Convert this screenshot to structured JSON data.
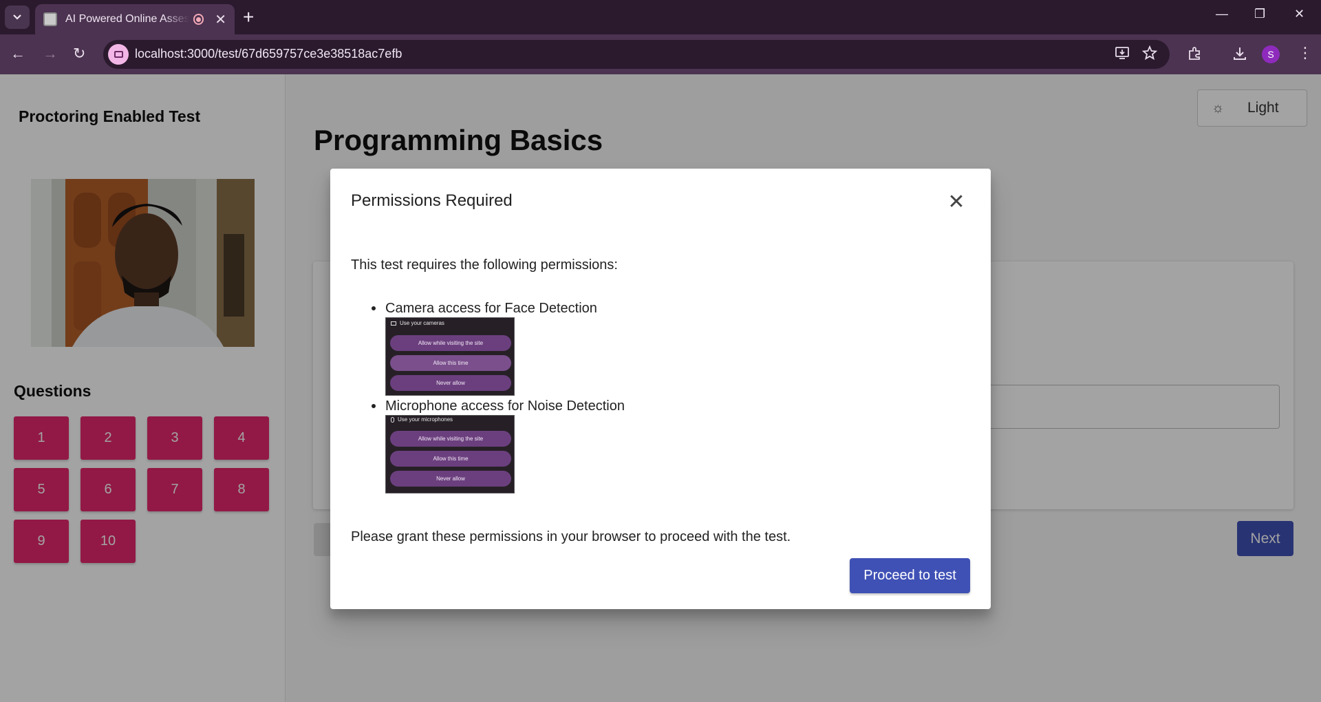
{
  "browser": {
    "tab_title": "AI Powered Online Assessment",
    "tab_close": "✕",
    "new_tab": "+",
    "url": "localhost:3000/test/67d659757ce3e38518ac7efb",
    "profile_initial": "S",
    "window_controls": {
      "minimize": "—",
      "restore": "❐",
      "close": "✕"
    },
    "nav": {
      "back": "←",
      "forward": "→",
      "reload": "↻"
    }
  },
  "sidebar": {
    "title": "Proctoring Enabled Test",
    "questions_heading": "Questions",
    "question_buttons": [
      "1",
      "2",
      "3",
      "4",
      "5",
      "6",
      "7",
      "8",
      "9",
      "10"
    ]
  },
  "main": {
    "title": "Programming Basics",
    "theme_toggle_label": "Light",
    "next_label": "Next"
  },
  "dialog": {
    "title": "Permissions Required",
    "close_glyph": "✕",
    "intro": "This test requires the following permissions:",
    "permissions": [
      {
        "label": "Camera access for Face Detection",
        "prompt_heading": "Use your cameras",
        "options": [
          "Allow while visiting the site",
          "Allow this time",
          "Never allow"
        ]
      },
      {
        "label": "Microphone access for Noise Detection",
        "prompt_heading": "Use your microphones",
        "options": [
          "Allow while visiting the site",
          "Allow this time",
          "Never allow"
        ]
      }
    ],
    "footer_text": "Please grant these permissions in your browser to proceed with the test.",
    "proceed_label": "Proceed to test"
  },
  "colors": {
    "question_button": "#e4286c",
    "primary": "#3f51b5",
    "browser_frame": "#2b1a2e"
  }
}
